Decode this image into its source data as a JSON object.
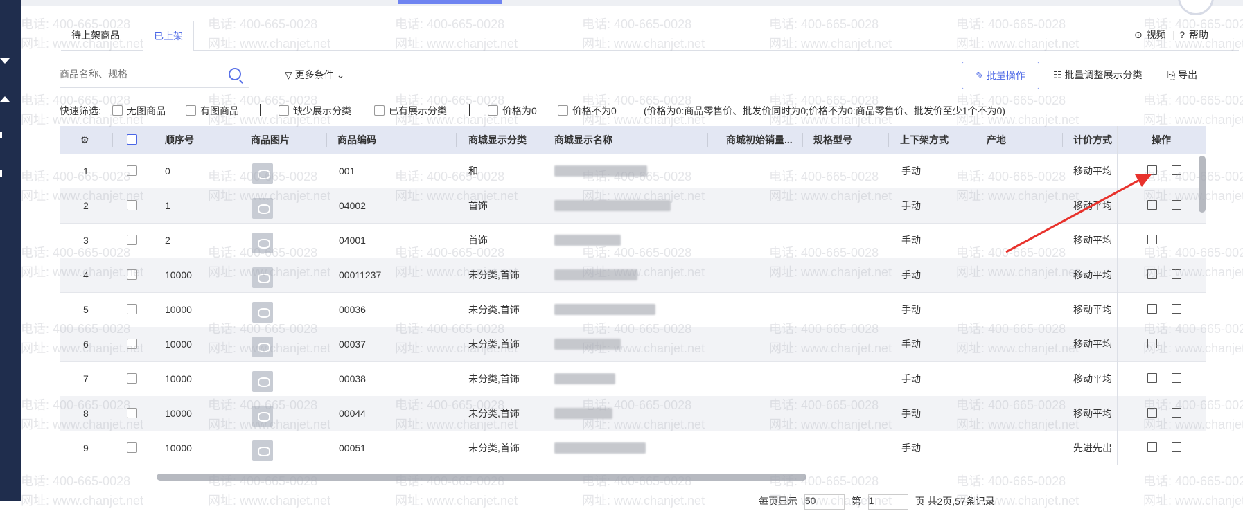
{
  "tabs": [
    "待上架商品",
    "已上架"
  ],
  "help": {
    "video": "视频",
    "sep": "|",
    "help": "帮助"
  },
  "search": {
    "placeholder": "商品名称、规格"
  },
  "filter": {
    "more": "更多条件"
  },
  "toolbar": {
    "batch": "批量操作",
    "adjust": "批量调整展示分类",
    "export": "导出"
  },
  "quick_filter": {
    "label": "快速筛选:",
    "options": [
      "无图商品",
      "有图商品",
      "缺少展示分类",
      "已有展示分类",
      "价格为0",
      "价格不为0"
    ],
    "note": "(价格为0:商品零售价、批发价同时为0;价格不为0:商品零售价、批发价至少1个不为0)"
  },
  "table": {
    "headers": [
      "顺序号",
      "商品图片",
      "商品编码",
      "商城显示分类",
      "商城显示名称",
      "商城初始销量...",
      "规格型号",
      "上下架方式",
      "产地",
      "计价方式",
      "操作"
    ],
    "rows": [
      {
        "idx": "1",
        "seq": "0",
        "code": "001",
        "cat": "和",
        "mode": "手动",
        "price": "移动平均"
      },
      {
        "idx": "2",
        "seq": "1",
        "code": "04002",
        "cat": "首饰",
        "mode": "手动",
        "price": "移动平均"
      },
      {
        "idx": "3",
        "seq": "2",
        "code": "04001",
        "cat": "首饰",
        "mode": "手动",
        "price": "移动平均"
      },
      {
        "idx": "4",
        "seq": "10000",
        "code": "00011237",
        "cat": "未分类,首饰",
        "mode": "手动",
        "price": "移动平均"
      },
      {
        "idx": "5",
        "seq": "10000",
        "code": "00036",
        "cat": "未分类,首饰",
        "mode": "手动",
        "price": "移动平均"
      },
      {
        "idx": "6",
        "seq": "10000",
        "code": "00037",
        "cat": "未分类,首饰",
        "mode": "手动",
        "price": "移动平均"
      },
      {
        "idx": "7",
        "seq": "10000",
        "code": "00038",
        "cat": "未分类,首饰",
        "mode": "手动",
        "price": "移动平均"
      },
      {
        "idx": "8",
        "seq": "10000",
        "code": "00044",
        "cat": "未分类,首饰",
        "mode": "手动",
        "price": "移动平均"
      },
      {
        "idx": "9",
        "seq": "10000",
        "code": "00051",
        "cat": "未分类,首饰",
        "mode": "手动",
        "price": "先进先出"
      }
    ]
  },
  "footer": {
    "per_page_label": "每页显示",
    "per_page": "50",
    "page_label": "第",
    "page": "1",
    "page_unit": "页",
    "summary": "共2页,57条记录"
  },
  "watermark": {
    "phone": "电话: 400-665-0028",
    "site": "网址: www.chanjet.net"
  },
  "colors": {
    "accent": "#4a66e6",
    "header_bg": "#e3e7f3",
    "sidebar": "#1f2d4d",
    "arrow": "#e8322c"
  }
}
